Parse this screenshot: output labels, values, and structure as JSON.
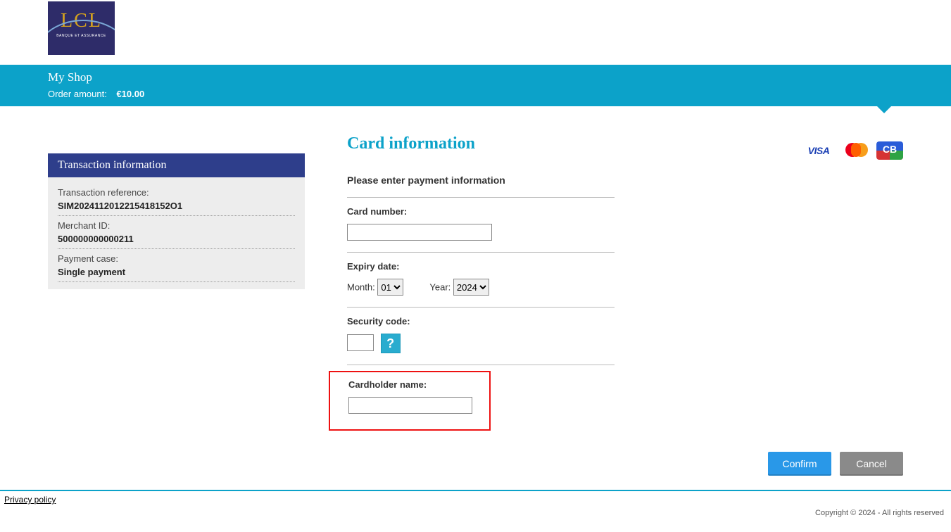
{
  "header": {
    "logo": {
      "name": "LCL",
      "sub": "BANQUE ET ASSURANCE"
    },
    "shop_name": "My Shop",
    "order_amount_label": "Order amount:",
    "order_amount_value": "€10.00"
  },
  "transaction_panel": {
    "title": "Transaction information",
    "fields": [
      {
        "label": "Transaction reference:",
        "value": "SIM2024112012215418152O1"
      },
      {
        "label": "Merchant ID:",
        "value": "500000000000211"
      },
      {
        "label": "Payment case:",
        "value": "Single payment"
      }
    ]
  },
  "card_form": {
    "title": "Card information",
    "intro": "Please enter payment information",
    "card_number_label": "Card number:",
    "expiry_label": "Expiry date:",
    "month_label": "Month:",
    "month_value": "01",
    "year_label": "Year:",
    "year_value": "2024",
    "security_label": "Security code:",
    "help_symbol": "?",
    "cardholder_label": "Cardholder name:"
  },
  "card_brands": {
    "visa": "VISA",
    "cb": "CB"
  },
  "actions": {
    "confirm": "Confirm",
    "cancel": "Cancel"
  },
  "footer": {
    "privacy": "Privacy policy",
    "copyright": "Copyright © 2024 - All rights reserved"
  }
}
